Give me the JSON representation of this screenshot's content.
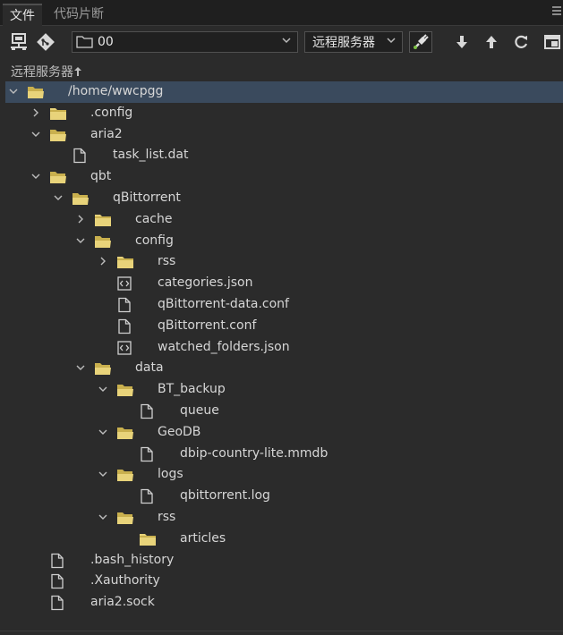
{
  "tabs": {
    "files": "文件",
    "snippets": "代码片断"
  },
  "toolbar": {
    "folder_select": "00",
    "server_select": "远程服务器"
  },
  "section_title": "远程服务器",
  "tree": [
    {
      "label": "/home/wwcpgg",
      "type": "folder",
      "depth": 0,
      "chevron": "down",
      "selected": true
    },
    {
      "label": ".config",
      "type": "folder",
      "depth": 1,
      "chevron": "right"
    },
    {
      "label": "aria2",
      "type": "folder",
      "depth": 1,
      "chevron": "down"
    },
    {
      "label": "task_list.dat",
      "type": "file",
      "depth": 2,
      "chevron": ""
    },
    {
      "label": "qbt",
      "type": "folder",
      "depth": 1,
      "chevron": "down"
    },
    {
      "label": "qBittorrent",
      "type": "folder",
      "depth": 2,
      "chevron": "down"
    },
    {
      "label": "cache",
      "type": "folder",
      "depth": 3,
      "chevron": "right"
    },
    {
      "label": "config",
      "type": "folder",
      "depth": 3,
      "chevron": "down"
    },
    {
      "label": "rss",
      "type": "folder",
      "depth": 4,
      "chevron": "right"
    },
    {
      "label": "categories.json",
      "type": "code",
      "depth": 4,
      "chevron": ""
    },
    {
      "label": "qBittorrent-data.conf",
      "type": "file",
      "depth": 4,
      "chevron": ""
    },
    {
      "label": "qBittorrent.conf",
      "type": "file",
      "depth": 4,
      "chevron": ""
    },
    {
      "label": "watched_folders.json",
      "type": "code",
      "depth": 4,
      "chevron": ""
    },
    {
      "label": "data",
      "type": "folder",
      "depth": 3,
      "chevron": "down"
    },
    {
      "label": "BT_backup",
      "type": "folder",
      "depth": 4,
      "chevron": "down"
    },
    {
      "label": "queue",
      "type": "file",
      "depth": 5,
      "chevron": ""
    },
    {
      "label": "GeoDB",
      "type": "folder",
      "depth": 4,
      "chevron": "down"
    },
    {
      "label": "dbip-country-lite.mmdb",
      "type": "file",
      "depth": 5,
      "chevron": ""
    },
    {
      "label": "logs",
      "type": "folder",
      "depth": 4,
      "chevron": "down"
    },
    {
      "label": "qbittorrent.log",
      "type": "file",
      "depth": 5,
      "chevron": ""
    },
    {
      "label": "rss",
      "type": "folder",
      "depth": 4,
      "chevron": "down"
    },
    {
      "label": "articles",
      "type": "folder",
      "depth": 5,
      "chevron": ""
    },
    {
      "label": ".bash_history",
      "type": "file",
      "depth": 1,
      "chevron": ""
    },
    {
      "label": ".Xauthority",
      "type": "file",
      "depth": 1,
      "chevron": ""
    },
    {
      "label": "aria2.sock",
      "type": "file",
      "depth": 1,
      "chevron": ""
    }
  ],
  "colors": {
    "folder": "#e8d37a",
    "folder_dark": "#c9b04e",
    "selected": "#3a4a5d"
  }
}
